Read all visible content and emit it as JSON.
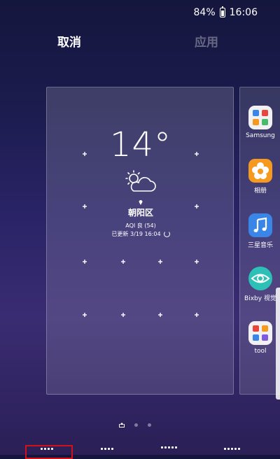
{
  "status_bar": {
    "battery": "84%",
    "time": "16:06"
  },
  "actions": {
    "cancel": "取消",
    "apply": "应用"
  },
  "weather_widget": {
    "temperature": "14°",
    "location": "朝阳区",
    "aqi": "AQI 良 (54)",
    "updated": "已更新 3/19 16:04",
    "icon": "partly-cloudy-icon"
  },
  "sidebar_apps": [
    {
      "label": "Samsung",
      "icon": "samsung-folder-icon"
    },
    {
      "label": "相册",
      "icon": "gallery-icon",
      "color": "#f59a1f"
    },
    {
      "label": "三星音乐",
      "icon": "music-icon",
      "color": "#3a86e8"
    },
    {
      "label": "Bixby 视觉",
      "icon": "bixby-vision-icon",
      "color": "#2cc0b6"
    },
    {
      "label": "tool",
      "icon": "tool-folder-icon"
    }
  ],
  "page_indicator": {
    "pages": 3,
    "current": 1
  },
  "accent_color": "#d0121b"
}
